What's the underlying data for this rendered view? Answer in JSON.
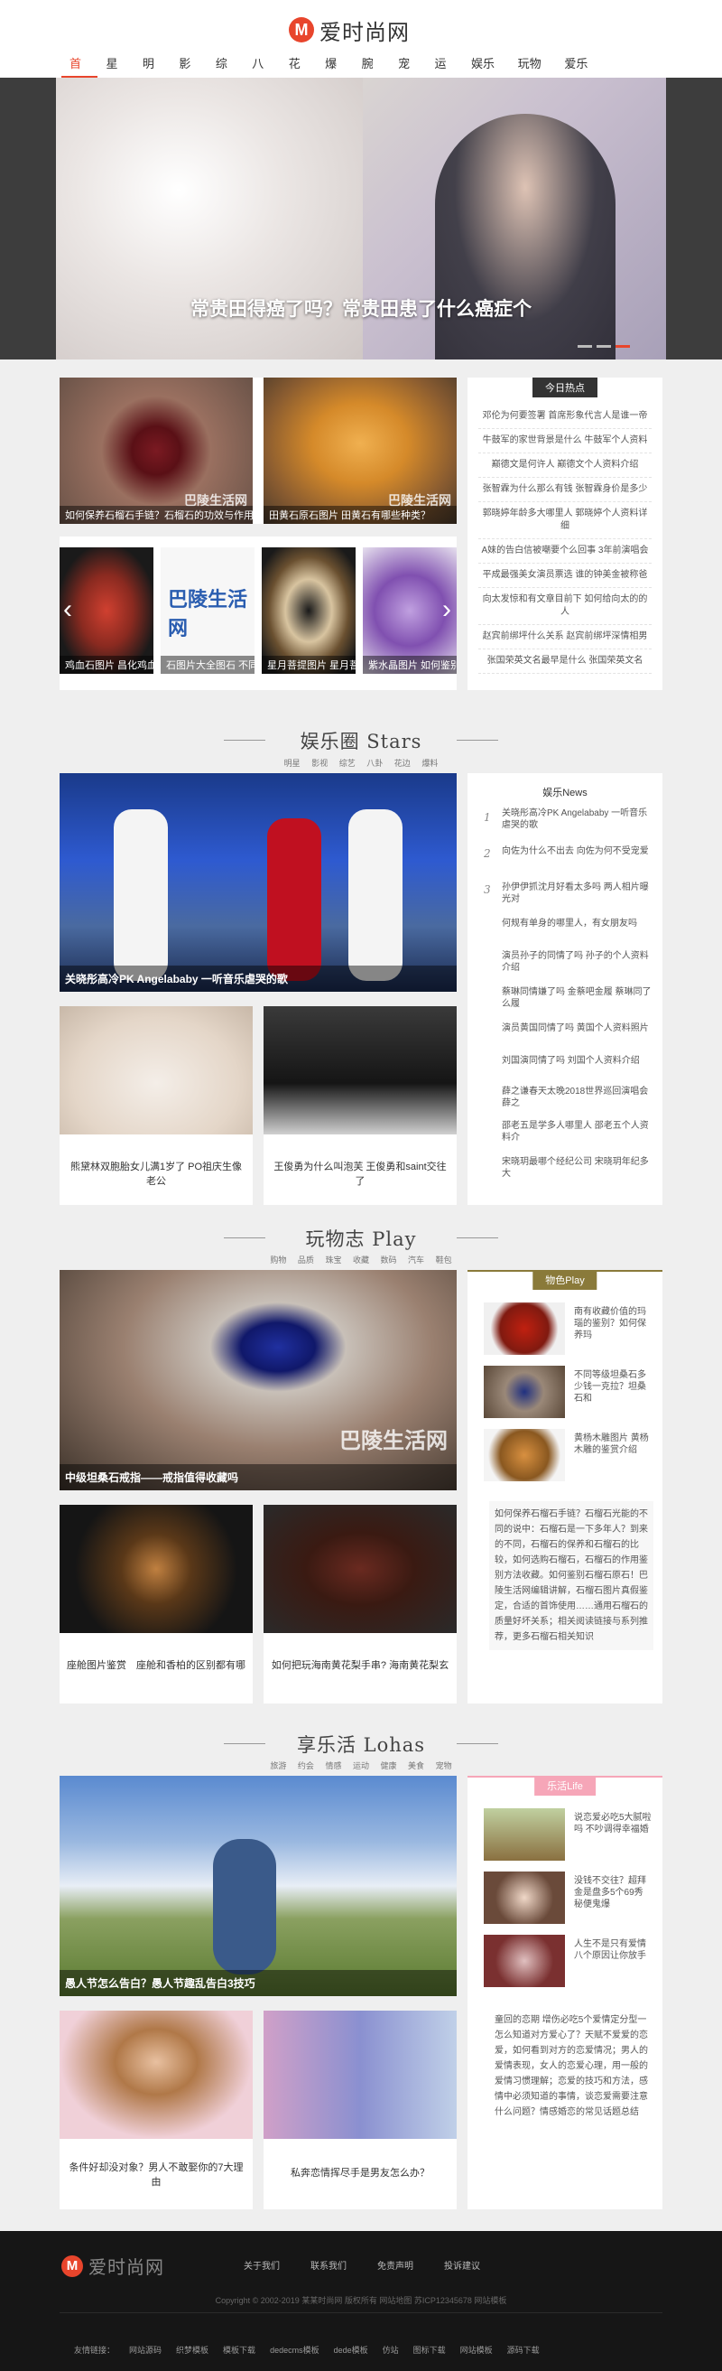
{
  "logo": {
    "mark": "M",
    "text": "爱时尚网"
  },
  "nav": [
    "首页",
    "星秀",
    "明星",
    "影视",
    "综艺",
    "八卦",
    "花边",
    "爆料",
    "腕表",
    "宠物",
    "运动",
    "娱乐圈",
    "玩物志",
    "爱乐活"
  ],
  "hero": {
    "title": "常贵田得癌了吗？常贵田患了什么癌症个"
  },
  "gallery": {
    "big": [
      {
        "caption": "如何保养石榴石手链？石榴石的功效与作用"
      },
      {
        "caption": "田黄石原石图片 田黄石有哪些种类？"
      }
    ],
    "small": [
      {
        "caption": "鸡血石图片 昌化鸡血石鉴别"
      },
      {
        "caption": "石图片大全图石 不同颜色的石头"
      },
      {
        "caption": "星月菩提图片 星月菩提手串有什么讲究"
      },
      {
        "caption": "紫水晶图片 如何鉴别紫水晶"
      }
    ],
    "watermark": "巴陵生活网",
    "arrow_left": "‹",
    "arrow_right": "›"
  },
  "hot": {
    "tab": "今日热点",
    "items": [
      "邓伦为何要签署 首席形象代言人是谁一帝",
      "牛鼓军的家世背景是什么 牛鼓军个人资料",
      "巅德文是何许人 巅德文个人资料介绍",
      "张智霖为什么那么有钱 张智霖身价是多少",
      "郭晓婷年龄多大哪里人 郭晓婷个人资料详细",
      "A妹的告白信被嘲要个么回事 3年前演唱会",
      "平成最强美女演员票选 谁的钟美金被称爸",
      "向太发惊和有文章目前下 如何给向太的的人",
      "赵宾前绑坪什么关系 赵宾前绑坪深情相男",
      "张国荣英文名最早是什么 张国荣英文名"
    ]
  },
  "stars": {
    "title": "娱乐圈 Stars",
    "sub": [
      "明星",
      "影视",
      "综艺",
      "八卦",
      "花边",
      "爆料"
    ],
    "main_caption": "关晓彤高冷PK Angelababy 一听音乐虐哭的歌",
    "cards": [
      {
        "title": "熊黛林双胞胎女儿满1岁了 PO祖庆生像老公"
      },
      {
        "title": "王俊勇为什么叫泡芙 王俊勇和saint交往了"
      }
    ],
    "side_tab": "娱乐News",
    "news": [
      {
        "num": "1",
        "text": "关晓彤高冷PK Angelababy 一听音乐虐哭的歌"
      },
      {
        "num": "2",
        "text": "向佐为什么不出去 向佐为何不受宠爱"
      },
      {
        "num": "3",
        "text": "孙伊伊抓沈月好看太多吗 两人相片曝光对"
      },
      {
        "num": "",
        "text": "何规有单身的哪里人，有女朋友吗"
      },
      {
        "num": "",
        "text": "演员孙子的同情了吗 孙子的个人资料介绍"
      },
      {
        "num": "",
        "text": "蔡琳同情嫌了吗 金蔡吧金履 蔡琳同了么履"
      },
      {
        "num": "",
        "text": "演员黄国同情了吗 黄国个人资料照片"
      },
      {
        "num": "",
        "text": "刘国演同情了吗 刘国个人资料介绍"
      },
      {
        "num": "",
        "text": "薛之谦春天太晚2018世界巡回演唱会 薛之"
      },
      {
        "num": "",
        "text": "邵老五是学多人哪里人 邵老五个人资料介"
      },
      {
        "num": "",
        "text": "宋晓玥最哪个经纪公司 宋晓玥年纪多大"
      }
    ]
  },
  "play": {
    "title": "玩物志 Play",
    "sub": [
      "购物",
      "品质",
      "珠宝",
      "收藏",
      "数码",
      "汽车",
      "鞋包"
    ],
    "main_caption": "中级坦桑石戒指——戒指值得收藏吗",
    "cards": [
      {
        "title": "座舱图片鉴赏　座舱和香柏的区别都有哪"
      },
      {
        "title": "如何把玩海南黄花梨手串? 海南黄花梨玄"
      }
    ],
    "side_tab": "物色Play",
    "items": [
      {
        "text": "南有收藏价值的玛瑙的鉴别？如何保养玛"
      },
      {
        "text": "不同等级坦桑石多少钱一克拉？坦桑石和"
      },
      {
        "text": "黄杨木雕图片 黄杨木雕的鉴赏介绍"
      }
    ],
    "text": "如何保养石榴石手链？石榴石光能的不同的说中：石榴石是一下多年人？到来的不同，石榴石的保养和石榴石的比较，如何选购石榴石，石榴石的作用鉴别方法收藏。如何鉴别石榴石原石！巴陵生活网编辑讲解，石榴石图片真假鉴定，合适的首饰使用……通用石榴石的质量好坏关系；相关阅读链接与系列推荐，更多石榴石相关知识"
  },
  "life": {
    "title": "享乐活 Lohas",
    "sub": [
      "旅游",
      "约会",
      "情感",
      "运动",
      "健康",
      "美食",
      "宠物"
    ],
    "main_caption": "愚人节怎么告白？愚人节趣乱告白3技巧",
    "cards": [
      {
        "title": "条件好却没对象？男人不敢娶你的7大理由"
      },
      {
        "title": "私奔恋情挥尽手是男友怎么办？"
      }
    ],
    "side_tab": "乐活Life",
    "items": [
      {
        "text": "说恋爱必吃5大腻啦吗 不吵调得幸福婚"
      },
      {
        "text": "没钱不交往？超拜金是盘多5个69秀秘便鬼爆"
      },
      {
        "text": "人生不是只有爱情 八个原因让你放手"
      }
    ],
    "text": "童回的恋期 增伤必吃5个爱情定分型一怎么知道对方爱心了？天赋不爱爱的恋爱，如何看到对方的恋爱情况；男人的爱情表现，女人的恋爱心理，用一般的爱情习惯理解；恋爱的技巧和方法，感情中必须知道的事情，谈恋爱需要注意什么问题？情感婚恋的常见话题总结"
  },
  "footer": {
    "links": [
      "关于我们",
      "联系我们",
      "免责声明",
      "投诉建议"
    ],
    "copyright": "Copyright © 2002-2019 某某时尚网 版权所有 网站地图 苏ICP12345678 网站模板",
    "friends_label": "友情链接：",
    "friends": [
      "网站源码",
      "织梦模板",
      "模板下载",
      "dedecms模板",
      "dede模板",
      "仿站",
      "图标下载",
      "网站模板",
      "源码下载"
    ]
  },
  "colors": {
    "accent": "#e8452c",
    "hot_tab": "#333333",
    "stars_tab": "#ffffff",
    "play_tab": "#8a7a3a",
    "life_tab": "#f6a6b8"
  }
}
